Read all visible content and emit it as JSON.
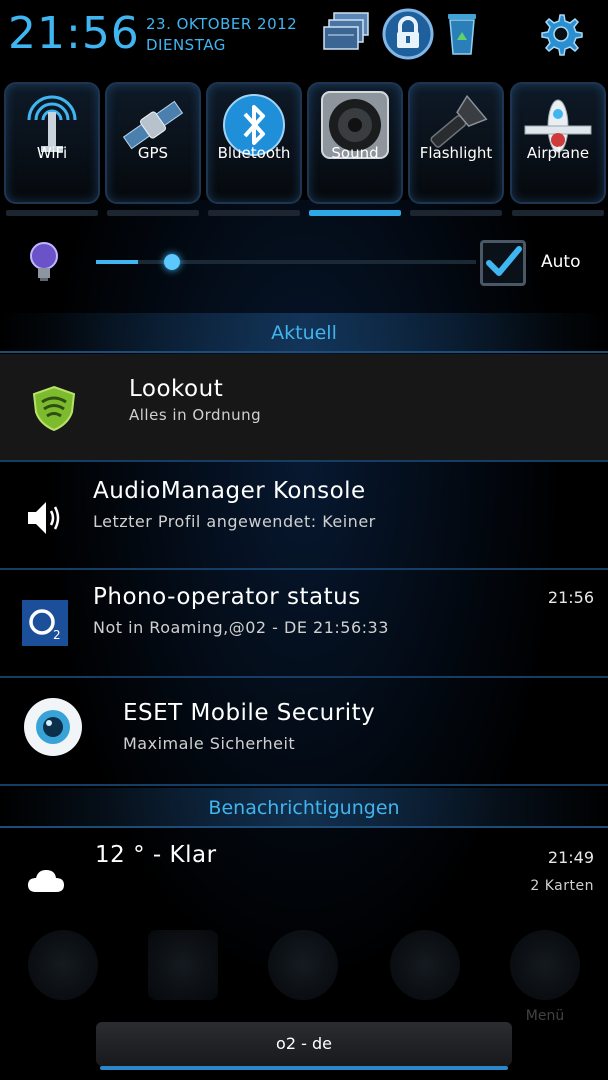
{
  "header": {
    "clock": "21:56",
    "date_line1": "23. OKTOBER 2012",
    "date_line2": "DIENSTAG",
    "icons": [
      "windows-stack-icon",
      "lock-icon",
      "recycle-bin-icon",
      "settings-gear-icon"
    ]
  },
  "toggles": [
    {
      "label": "WiFi",
      "icon": "wifi-antenna-icon",
      "active": false
    },
    {
      "label": "GPS",
      "icon": "satellite-icon",
      "active": false
    },
    {
      "label": "Bluetooth",
      "icon": "bluetooth-icon",
      "active": false
    },
    {
      "label": "Sound",
      "icon": "speaker-icon",
      "active": true
    },
    {
      "label": "Flashlight",
      "icon": "flashlight-icon",
      "active": false
    },
    {
      "label": "Airplane",
      "icon": "airplane-icon",
      "active": false
    }
  ],
  "brightness": {
    "level": 0.11,
    "auto_checked": true,
    "auto_label": "Auto"
  },
  "sections": {
    "current": "Aktuell",
    "notifications": "Benachrichtigungen"
  },
  "ongoing": [
    {
      "title": "Lookout",
      "subtitle": "Alles in Ordnung",
      "time": "",
      "icon": "lookout-shield-icon"
    },
    {
      "title": "AudioManager Konsole",
      "subtitle": "Letzter Profil angewendet: Keiner",
      "time": "",
      "icon": "speaker-sound-icon"
    },
    {
      "title": "Phono-operator status",
      "subtitle": "Not in Roaming,@02 - DE 21:56:33",
      "time": "21:56",
      "icon": "o2-logo-icon"
    },
    {
      "title": "ESET Mobile Security",
      "subtitle": "Maximale Sicherheit",
      "time": "",
      "icon": "eset-eye-icon"
    }
  ],
  "notifications": [
    {
      "title": "12 ° - Klar",
      "subtitle": "2 Karten",
      "time": "21:49",
      "icon": "cloud-icon"
    }
  ],
  "dock": {
    "visible_label": "Menü"
  },
  "carrier": "o2 - de",
  "colors": {
    "accent": "#3fb6f2",
    "divider": "#163d63"
  }
}
